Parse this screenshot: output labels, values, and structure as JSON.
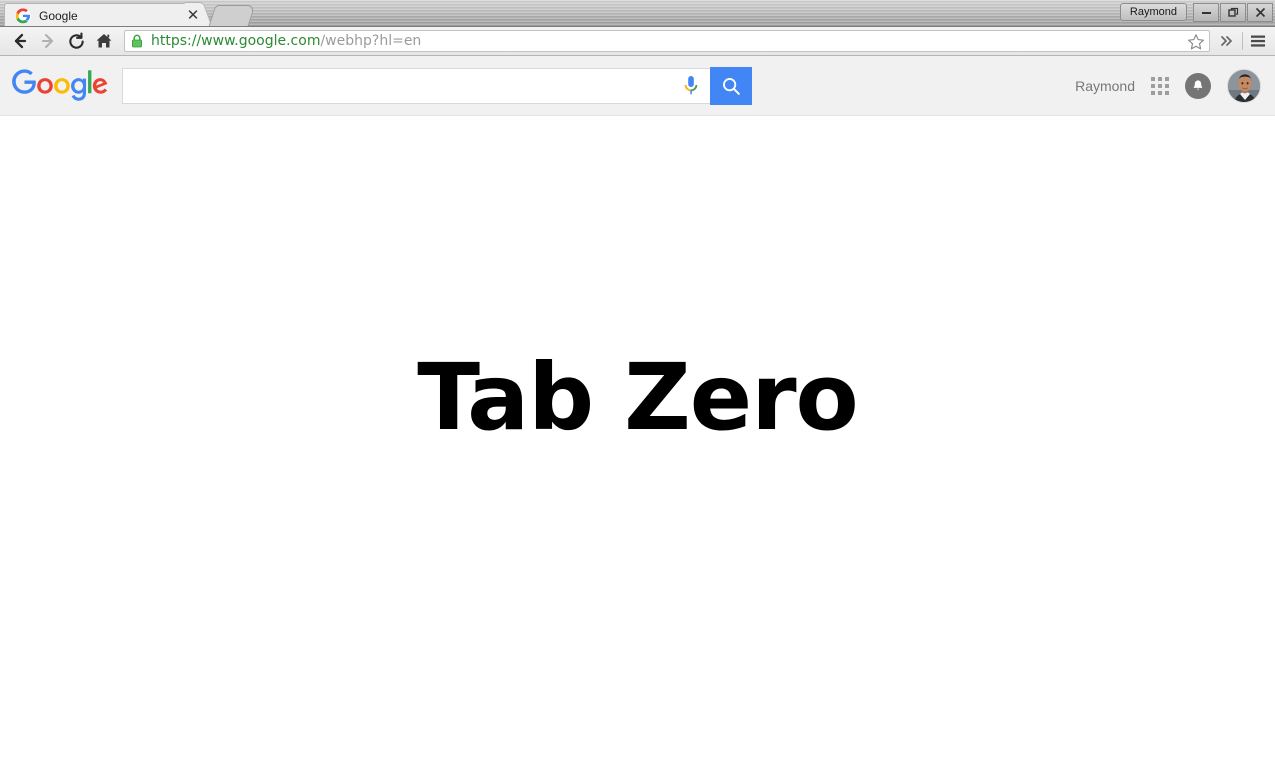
{
  "window": {
    "profile_label": "Raymond",
    "minimize_label": "—",
    "restore_label": "❐",
    "close_label": "✕"
  },
  "tabstrip": {
    "tabs": [
      {
        "title": "Google",
        "favicon": "google-g-icon",
        "close_label": "✕"
      }
    ],
    "new_tab_label": ""
  },
  "toolbar": {
    "back_label": "←",
    "forward_label": "→",
    "reload_label": "⟳",
    "home_label": "home-icon",
    "lock_icon": "padlock-secure-icon",
    "url_secure": "https://www.google.com",
    "url_rest": "/webhp?hl=en",
    "url_full": "https://www.google.com/webhp?hl=en",
    "bookmark_label": "☆",
    "overflow_label": "»",
    "menu_label": "≡"
  },
  "google_header": {
    "logo_text": "Google",
    "logo_colors": [
      "#4285f4",
      "#ea4335",
      "#fbbc05",
      "#4285f4",
      "#34a853",
      "#ea4335"
    ],
    "search": {
      "value": "",
      "placeholder": "",
      "mic_icon": "microphone-icon",
      "search_button_icon": "magnifier-icon",
      "search_button_color": "#4285f4"
    },
    "username": "Raymond",
    "apps_icon": "apps-grid-icon",
    "notifications_icon": "bell-icon",
    "avatar_icon": "user-avatar"
  },
  "page": {
    "headline": "Tab Zero"
  },
  "colors": {
    "header_band": "#f1f1f1",
    "accent_blue": "#4285f4",
    "secure_green": "#2d8a33",
    "url_gray": "#9b9b9b",
    "page_background": "#ffffff"
  }
}
